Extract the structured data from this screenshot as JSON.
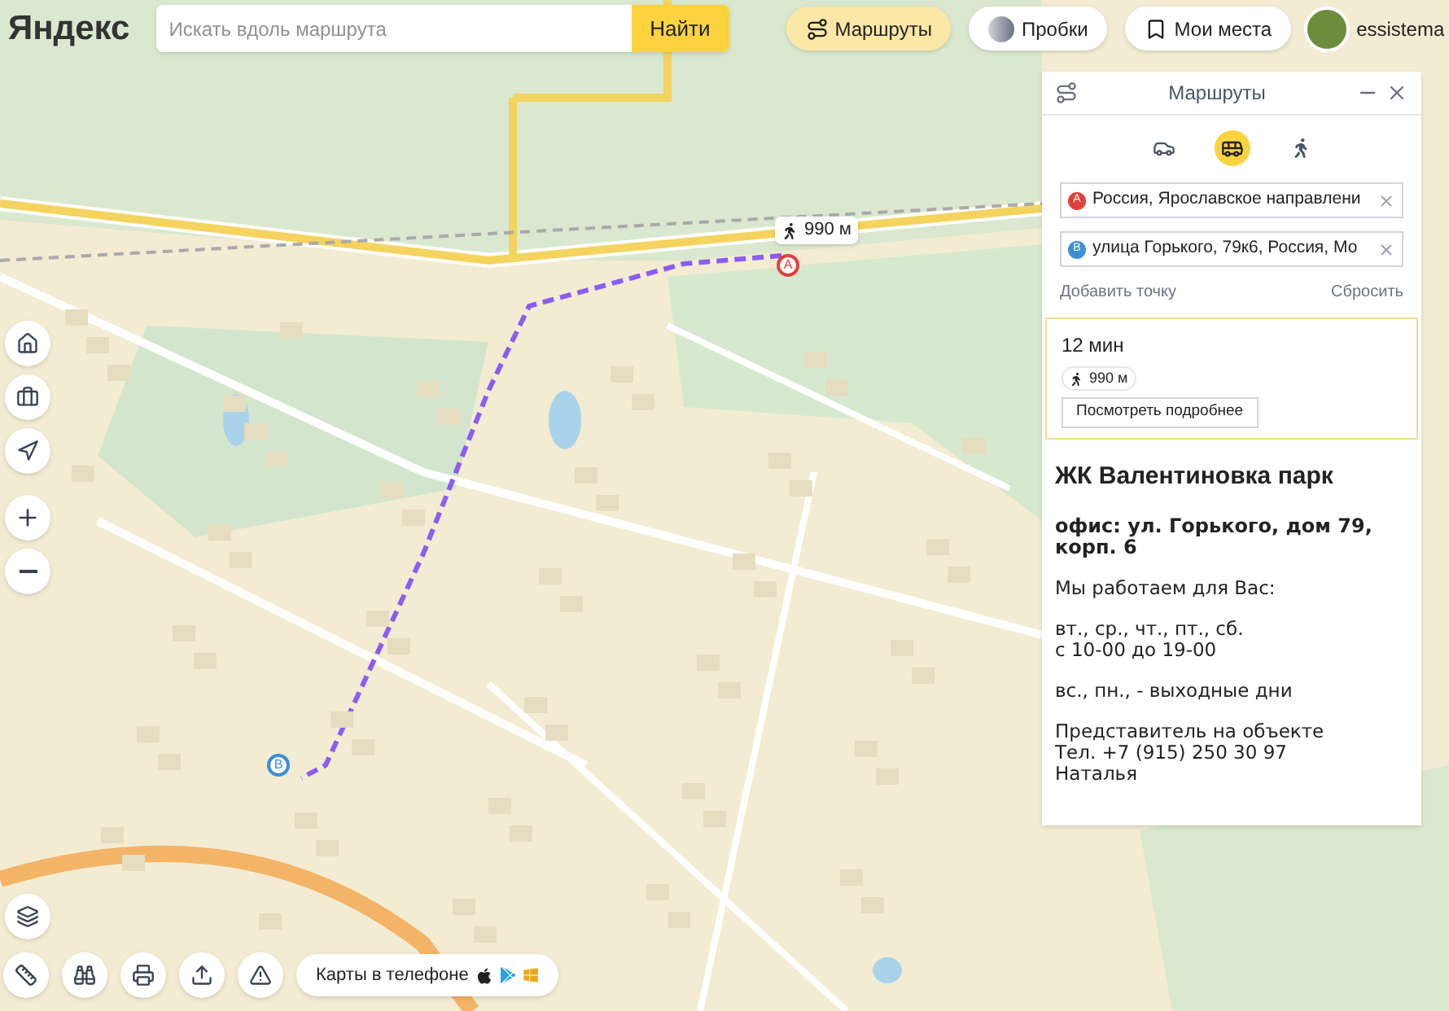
{
  "logo": "Яндекс",
  "search": {
    "placeholder": "Искать вдоль маршрута",
    "button": "Найти"
  },
  "top_buttons": [
    {
      "kind": "routes",
      "label": "Маршруты",
      "selected": true
    },
    {
      "kind": "traffic",
      "label": "Пробки",
      "selected": false
    },
    {
      "kind": "places",
      "label": "Мои места",
      "selected": false
    }
  ],
  "user": {
    "name": "essistema"
  },
  "route_badge": {
    "distance": "990 м"
  },
  "markers": [
    {
      "letter": "A",
      "color": "#e0413a"
    },
    {
      "letter": "B",
      "color": "#3b8fd9"
    }
  ],
  "panel": {
    "title": "Маршруты",
    "modes": [
      {
        "kind": "car",
        "selected": false
      },
      {
        "kind": "transit",
        "selected": true
      },
      {
        "kind": "walk",
        "selected": false
      }
    ],
    "points": [
      {
        "letter": "A",
        "color": "#e0413a",
        "value": "Россия, Ярославское направлени"
      },
      {
        "letter": "B",
        "color": "#3b8fd9",
        "value": "улица Горького, 79к6, Россия, Мо"
      }
    ],
    "add_point": "Добавить точку",
    "reset": "Сбросить",
    "result": {
      "time": "12 мин",
      "walk": "990 м",
      "details_button": "Посмотреть подробнее"
    }
  },
  "info": {
    "title": "ЖК Валентиновка парк",
    "address": "офис: ул. Горького, дом 79, корп. 6",
    "paragraphs": [
      "Мы работаем для Вас:",
      "вт., ср., чт., пт., сб.\nс 10-00 до 19-00",
      "вс., пн., - выходные дни",
      "Представитель на объекте\nТел. +7 (915) 250 30 97\nНаталья"
    ]
  },
  "app_promo": {
    "label": "Карты в телефоне"
  }
}
